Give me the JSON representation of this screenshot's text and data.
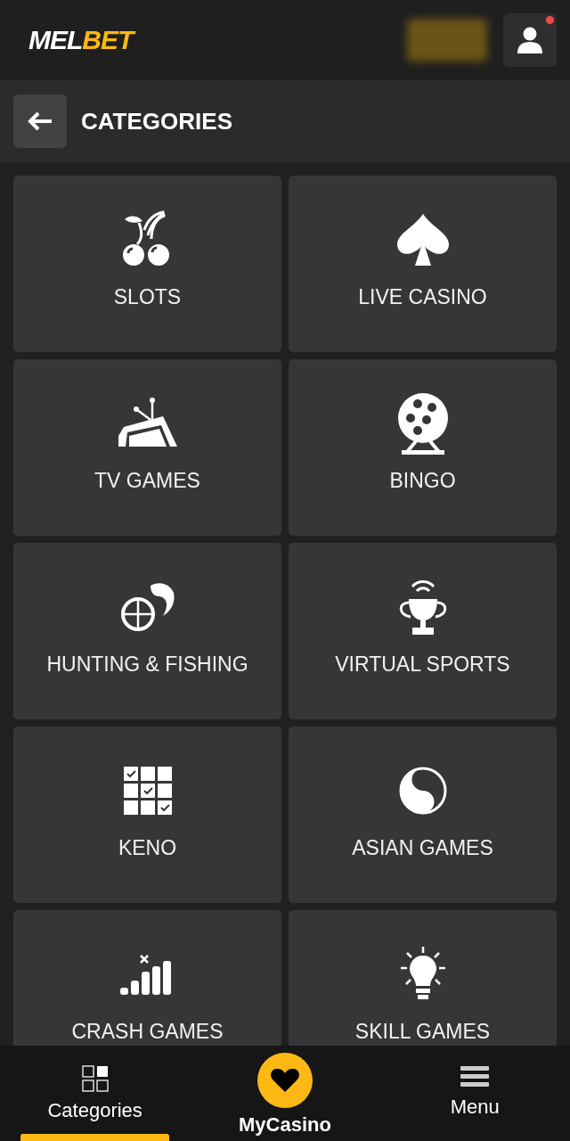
{
  "header": {
    "logo": [
      "MEL",
      "BET"
    ],
    "notification": true
  },
  "subheader": {
    "title": "CATEGORIES"
  },
  "categories": [
    {
      "label": "SLOTS",
      "kind": "cherries"
    },
    {
      "label": "LIVE CASINO",
      "kind": "spade"
    },
    {
      "label": "TV GAMES",
      "kind": "tv"
    },
    {
      "label": "BINGO",
      "kind": "lottery"
    },
    {
      "label": "HUNTING & FISHING",
      "kind": "hunt"
    },
    {
      "label": "VIRTUAL SPORTS",
      "kind": "trophy"
    },
    {
      "label": "KENO",
      "kind": "keno"
    },
    {
      "label": "ASIAN GAMES",
      "kind": "yinyang"
    },
    {
      "label": "CRASH GAMES",
      "kind": "crash"
    },
    {
      "label": "SKILL GAMES",
      "kind": "bulb"
    }
  ],
  "bottom_nav": [
    {
      "label": "Categories",
      "kind": "grid",
      "selected": true
    },
    {
      "label": "MyCasino",
      "kind": "heart",
      "selected": false
    },
    {
      "label": "Menu",
      "kind": "menu",
      "selected": false
    }
  ]
}
